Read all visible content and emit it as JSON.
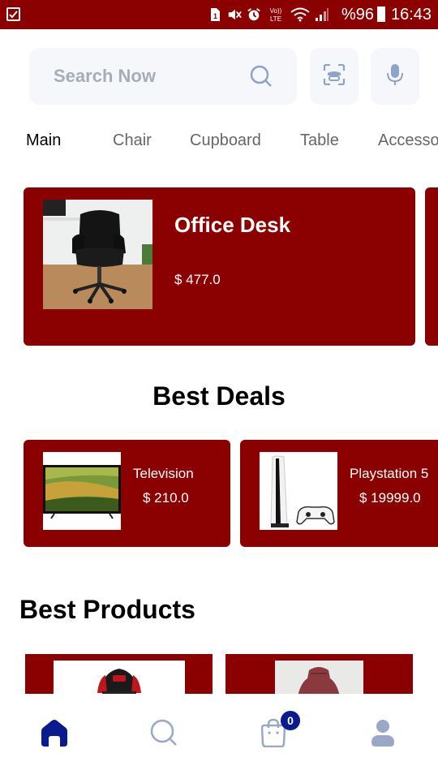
{
  "status_bar": {
    "battery_percent": "%96",
    "time": "16:43",
    "icons": [
      "checkbox-icon",
      "sim-icon",
      "mute-icon",
      "alarm-icon",
      "volte-icon",
      "wifi-icon",
      "signal-icon",
      "battery-icon"
    ],
    "volte_label": "Vo)) LTE"
  },
  "search": {
    "placeholder": "Search Now",
    "icons": [
      "search-icon",
      "scan-icon",
      "mic-icon"
    ]
  },
  "categories": {
    "items": [
      "Main",
      "Chair",
      "Cupboard",
      "Table",
      "Accesso"
    ],
    "active": "Main"
  },
  "featured": {
    "title": "Office Desk",
    "price": "$ 477.0",
    "image": "office-chair-image"
  },
  "best_deals": {
    "heading": "Best Deals",
    "items": [
      {
        "name": "Television",
        "price": "$ 210.0",
        "image": "television-image"
      },
      {
        "name": "Playstation 5",
        "price": "$ 19999.0",
        "image": "playstation-image"
      }
    ]
  },
  "best_products": {
    "heading": "Best Products",
    "items": [
      {
        "image": "gaming-chair-image"
      },
      {
        "image": "vase-image"
      }
    ]
  },
  "bottom_nav": {
    "items": [
      "home-icon",
      "search-icon",
      "cart-icon",
      "profile-icon"
    ],
    "cart_count": "0",
    "active": "home"
  },
  "colors": {
    "brand": "#8B0000",
    "nav_active": "#0a1b8f",
    "nav_inactive": "#9aa8c5",
    "input_bg": "#f5f7fb"
  }
}
